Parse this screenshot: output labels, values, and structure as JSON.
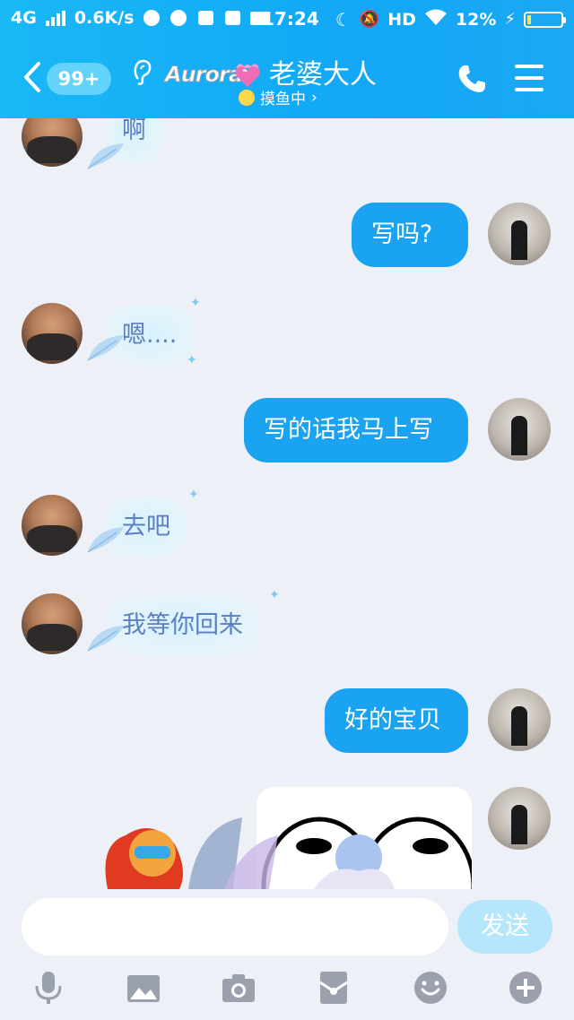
{
  "status_bar": {
    "network": "4G",
    "speed": "0.6K/s",
    "time": "17:24",
    "hd": "HD",
    "battery_percent": "12%",
    "battery_level": 0.12
  },
  "header": {
    "back_badge": "99+",
    "nickname_logo": "Aurora",
    "title": "老婆大人",
    "status": "摸鱼中",
    "status_chevron": "›",
    "bg_color": "#12a8f5"
  },
  "messages": [
    {
      "side": "in",
      "text": "啊"
    },
    {
      "side": "out",
      "text": "写吗?"
    },
    {
      "side": "in",
      "text": "嗯...."
    },
    {
      "side": "out",
      "text": "写的话我马上写"
    },
    {
      "side": "in",
      "text": "去吧"
    },
    {
      "side": "in",
      "text": "我等你回来"
    },
    {
      "side": "out",
      "text": "好的宝贝"
    },
    {
      "side": "out",
      "type": "image"
    }
  ],
  "input": {
    "placeholder": "",
    "send_label": "发送"
  },
  "toolbar": {
    "icons": [
      "microphone-icon",
      "image-icon",
      "camera-icon",
      "red-packet-icon",
      "emoji-icon",
      "plus-icon"
    ]
  },
  "colors": {
    "bubble_out": "#1aa3f0",
    "bubble_in_text": "#5c7fc4",
    "chat_bg": "#edf0f6"
  }
}
